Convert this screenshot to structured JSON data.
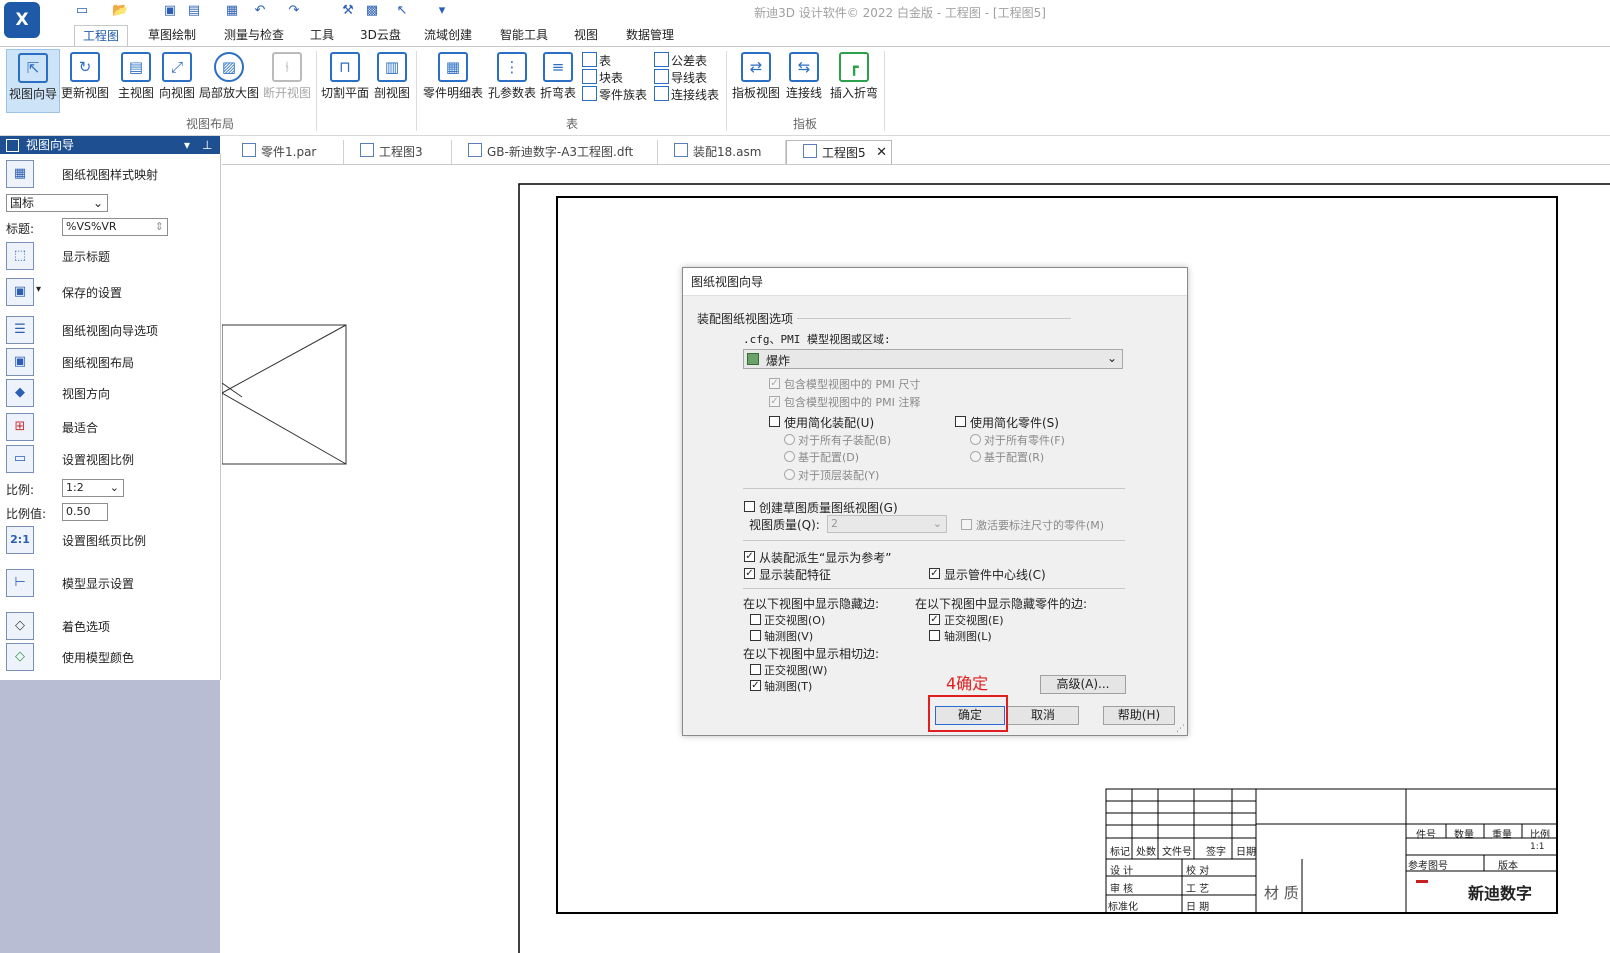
{
  "app": {
    "window_title": "新迪3D 设计软件© 2022 白金版 - 工程图 - [工程图5]",
    "logo_text": "X"
  },
  "ribbon_tabs": [
    "工程图",
    "草图绘制",
    "测量与检查",
    "工具",
    "3D云盘",
    "流域创建",
    "智能工具",
    "视图",
    "数据管理"
  ],
  "ribbon": {
    "buttons": [
      "视图向导",
      "更新视图",
      "主视图",
      "向视图",
      "局部放大图",
      "断开视图",
      "切割平面",
      "剖视图",
      "零件明细表",
      "孔参数表",
      "折弯表",
      "指板视图",
      "连接线",
      "插入折弯"
    ],
    "table_small": [
      "表",
      "块表",
      "零件族表",
      "公差表",
      "导线表",
      "连接线表"
    ],
    "groups": [
      "视图布局",
      "表",
      "指板"
    ]
  },
  "left_panel": {
    "title": "视图向导",
    "rows": [
      "图纸视图样式映射",
      "显示标题",
      "保存的设置",
      "图纸视图向导选项",
      "图纸视图布局",
      "视图方向",
      "最适合",
      "设置视图比例",
      "设置图纸页比例",
      "模型显示设置",
      "着色选项",
      "使用模型颜色"
    ],
    "standard_value": "国标",
    "title_label": "标题:",
    "title_value": "%VS%VR",
    "scale_label": "比例:",
    "scale_value": "1:2",
    "scale_value_label": "比例值:",
    "scale_number": "0.50",
    "scale_icon_text": "2:1"
  },
  "doc_tabs": [
    "零件1.par",
    "工程图3",
    "GB-新迪数字-A3工程图.dft",
    "装配18.asm",
    "工程图5"
  ],
  "dialog": {
    "title": "图纸视图向导",
    "section_title": "装配图纸视图选项",
    "cfg_label": ".cfg、PMI 模型视图或区域:",
    "cfg_value": "爆炸",
    "include_pmi_dim": "包含模型视图中的 PMI 尺寸",
    "include_pmi_note": "包含模型视图中的 PMI 注释",
    "use_simplified_assembly": "使用简化装配(U)",
    "all_subassemblies": "对于所有子装配(B)",
    "based_on_config_1": "基于配置(D)",
    "top_level_assembly": "对于顶层装配(Y)",
    "use_simplified_part": "使用简化零件(S)",
    "all_parts": "对于所有零件(F)",
    "based_on_config_2": "基于配置(R)",
    "create_draft_quality": "创建草图质量图纸视图(G)",
    "view_quality_label": "视图质量(Q):",
    "view_quality_value": "2",
    "activate_parts": "激活要标注尺寸的零件(M)",
    "derive_reference": "从装配派生“显示为参考”",
    "show_assembly_features": "显示装配特征",
    "show_tube_centerline": "显示管件中心线(C)",
    "hidden_edges_title": "在以下视图中显示隐藏边:",
    "hidden_ortho": "正交视图(O)",
    "hidden_iso": "轴测图(V)",
    "hidden_parts_title": "在以下视图中显示隐藏零件的边:",
    "hidden_parts_ortho": "正交视图(E)",
    "hidden_parts_iso": "轴测图(L)",
    "tangent_title": "在以下视图中显示相切边:",
    "tangent_ortho": "正交视图(W)",
    "tangent_iso": "轴测图(T)",
    "advanced_button": "高级(A)...",
    "ok_button": "确定",
    "cancel_button": "取消",
    "help_button": "帮助(H)",
    "check_mark": "✓"
  },
  "annotation": {
    "step_label": "4确定",
    "color": "#e02020"
  },
  "title_block": {
    "left_labels": [
      "标记",
      "处数",
      "文件号",
      "签字",
      "日期"
    ],
    "row_labels": [
      "设 计",
      "校 对",
      "审 核",
      "工 艺",
      "标准化",
      "日 期"
    ],
    "material": "材 质",
    "right_headers": [
      "件号",
      "数量",
      "重量",
      "比例"
    ],
    "scale_value": "1:1",
    "ref_label": "参考图号",
    "version_label": "版本",
    "brand": "新迪数字"
  }
}
